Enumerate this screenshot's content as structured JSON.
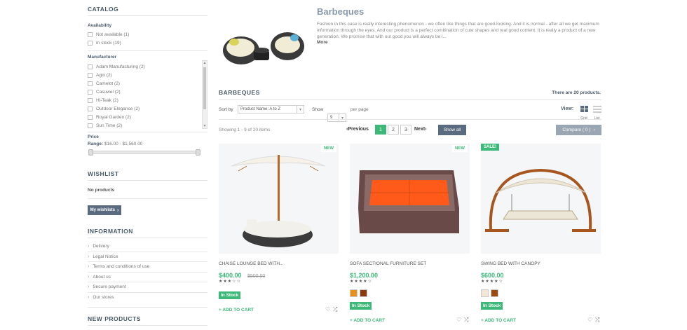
{
  "sidebar": {
    "catalog_title": "CATALOG",
    "availability_label": "Availability",
    "availability": [
      "Not available (1)",
      "In stock (19)"
    ],
    "manufacturer_label": "Manufacturer",
    "manufacturers": [
      "Adam Manufacturing (2)",
      "Agio (2)",
      "Camelot (2)",
      "Casuwel (2)",
      "Hi-Teak (2)",
      "Outdoor Elegance (2)",
      "Royal Garden (2)",
      "Sun Time (2)"
    ],
    "price_label": "Price",
    "range_label": "Range:",
    "range_value": "$16.00 - $1,560.00",
    "wishlist_title": "WISHLIST",
    "wishlist_text": "No products",
    "wishlist_button": "My wishlists",
    "information_title": "INFORMATION",
    "information_items": [
      "Delivery",
      "Legal Notice",
      "Terms and conditions of use",
      "About us",
      "Secure payment",
      "Our stores"
    ],
    "new_products_title": "NEW PRODUCTS"
  },
  "category": {
    "title": "Barbeques",
    "description": "Fashion in this case is really interesting phenomenon - we often like things that are good-looking. And it is normal - after all we get maximum information through the eyes. And our product is a perfect combination of cute shapes and real good content. It is really a product of a new generation. We promise that with our good you will always be i...",
    "more_label": "More"
  },
  "listing": {
    "heading": "BARBEQUES",
    "count_text": "There are 20 products.",
    "sort_label": "Sort by",
    "sort_value": "Product Name: A to Z",
    "show_label": "Show",
    "show_value": "9",
    "per_page_label": "per page",
    "view_label": "View:",
    "grid_label": "Grid",
    "list_label": "List",
    "showing_text": "Showing 1 - 9 of 20 items",
    "prev_label": "Previous",
    "next_label": "Next",
    "pages": [
      "1",
      "2",
      "3"
    ],
    "show_all_label": "Show all",
    "compare_label": "Compare ( 0 )"
  },
  "products": [
    {
      "badge": "NEW",
      "name": "CHAISE LOUNGE BED WITH...",
      "price": "$400.00",
      "old_price": "$500.00",
      "stars": "★★★☆☆",
      "stock": "In Stock",
      "add_to_cart": "+ ADD TO CART",
      "swatches": []
    },
    {
      "badge": "NEW",
      "name": "SOFA SECTIONAL FURNITURE SET",
      "price": "$1,200.00",
      "old_price": "",
      "stars": "★★★★☆",
      "stock": "In Stock",
      "add_to_cart": "+ ADD TO CART",
      "swatches": [
        "#e8901c",
        "#8a3a0e"
      ]
    },
    {
      "badge": "SALE!",
      "name": "SWING BED WITH CANOPY",
      "price": "$600.00",
      "old_price": "",
      "stars": "★★★★☆",
      "stock": "In Stock",
      "add_to_cart": "+ ADD TO CART",
      "swatches": [
        "#f4e6d6",
        "#9a4a0e"
      ]
    }
  ],
  "colors": {
    "accent": "#3cb878",
    "heading": "#4a5a6a",
    "button_dark": "#5a6b80",
    "compare_btn": "#9aa6b2"
  }
}
